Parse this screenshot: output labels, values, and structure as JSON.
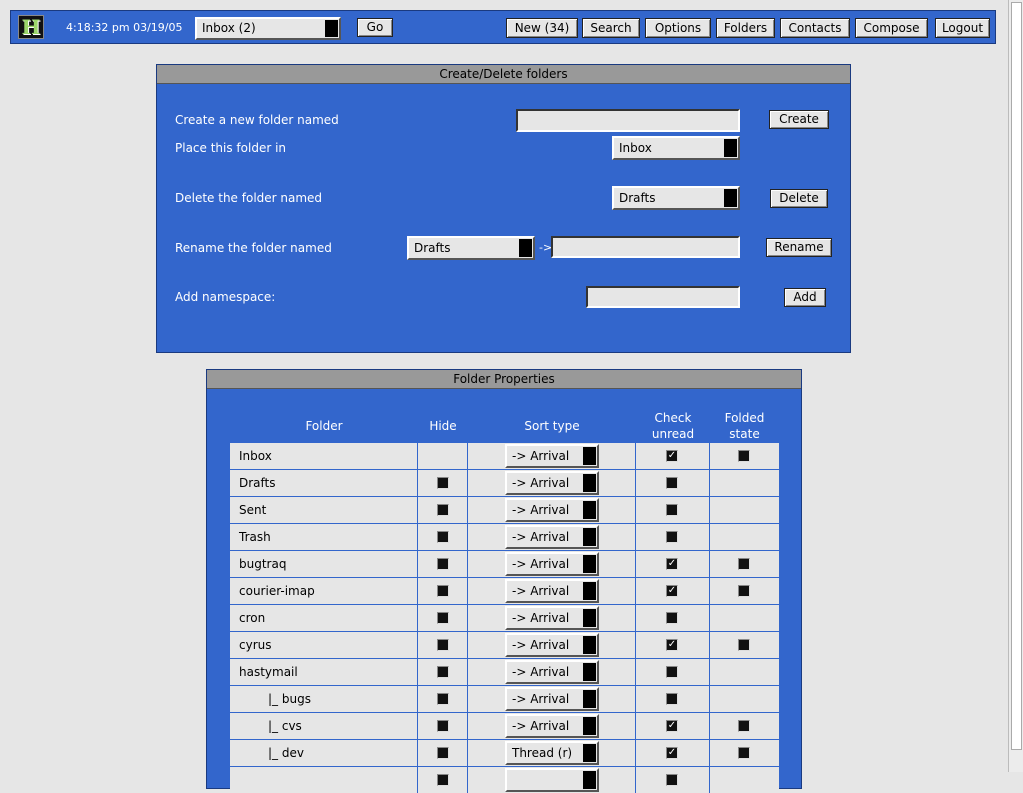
{
  "header": {
    "logo_text": "H",
    "clock": "4:18:32 pm 03/19/05",
    "mailbox_select": "Inbox  (2)",
    "go_label": "Go",
    "nav": [
      {
        "name": "nav-new-button",
        "label": "New (34)"
      },
      {
        "name": "nav-search-button",
        "label": "Search"
      },
      {
        "name": "nav-options-button",
        "label": "Options"
      },
      {
        "name": "nav-folders-button",
        "label": "Folders"
      },
      {
        "name": "nav-contacts-button",
        "label": "Contacts"
      },
      {
        "name": "nav-compose-button",
        "label": "Compose"
      },
      {
        "name": "nav-logout-button",
        "label": "Logout"
      }
    ]
  },
  "create_delete": {
    "title": "Create/Delete folders",
    "create_label": "Create a new folder named",
    "create_value": "",
    "create_button": "Create",
    "place_label": "Place this folder in",
    "place_value": "Inbox",
    "delete_label": "Delete the folder named",
    "delete_value": "Drafts",
    "delete_button": "Delete",
    "rename_label": "Rename the folder named",
    "rename_value": "Drafts",
    "rename_arrow": "->",
    "rename_new_value": "",
    "rename_button": "Rename",
    "namespace_label": "Add namespace:",
    "namespace_value": "",
    "namespace_button": "Add"
  },
  "properties": {
    "title": "Folder Properties",
    "columns": {
      "folder": "Folder",
      "hide": "Hide",
      "sort": "Sort type",
      "check_line1": "Check",
      "check_line2": "unread",
      "folded_line1": "Folded",
      "folded_line2": "state"
    },
    "rows": [
      {
        "name": "Inbox",
        "hide": null,
        "sort": "-> Arrival",
        "check": true,
        "folded": false
      },
      {
        "name": "Drafts",
        "hide": false,
        "sort": "-> Arrival",
        "check": false,
        "folded": null
      },
      {
        "name": "Sent",
        "hide": false,
        "sort": "-> Arrival",
        "check": false,
        "folded": null
      },
      {
        "name": "Trash",
        "hide": false,
        "sort": "-> Arrival",
        "check": false,
        "folded": null
      },
      {
        "name": "bugtraq",
        "hide": false,
        "sort": "-> Arrival",
        "check": true,
        "folded": false
      },
      {
        "name": "courier-imap",
        "hide": false,
        "sort": "-> Arrival",
        "check": true,
        "folded": false
      },
      {
        "name": "cron",
        "hide": false,
        "sort": "-> Arrival",
        "check": false,
        "folded": null
      },
      {
        "name": "cyrus",
        "hide": false,
        "sort": "-> Arrival",
        "check": true,
        "folded": false
      },
      {
        "name": "hastymail",
        "hide": false,
        "sort": "-> Arrival",
        "check": false,
        "folded": null
      },
      {
        "name": "|_ bugs",
        "hide": false,
        "sort": "-> Arrival",
        "check": false,
        "folded": null,
        "indent": true
      },
      {
        "name": "|_ cvs",
        "hide": false,
        "sort": "-> Arrival",
        "check": true,
        "folded": false,
        "indent": true
      },
      {
        "name": "|_ dev",
        "hide": false,
        "sort": "Thread (r)",
        "check": true,
        "folded": false,
        "indent": true
      },
      {
        "name": "",
        "hide": false,
        "sort": "",
        "check": false,
        "folded": null
      }
    ]
  }
}
